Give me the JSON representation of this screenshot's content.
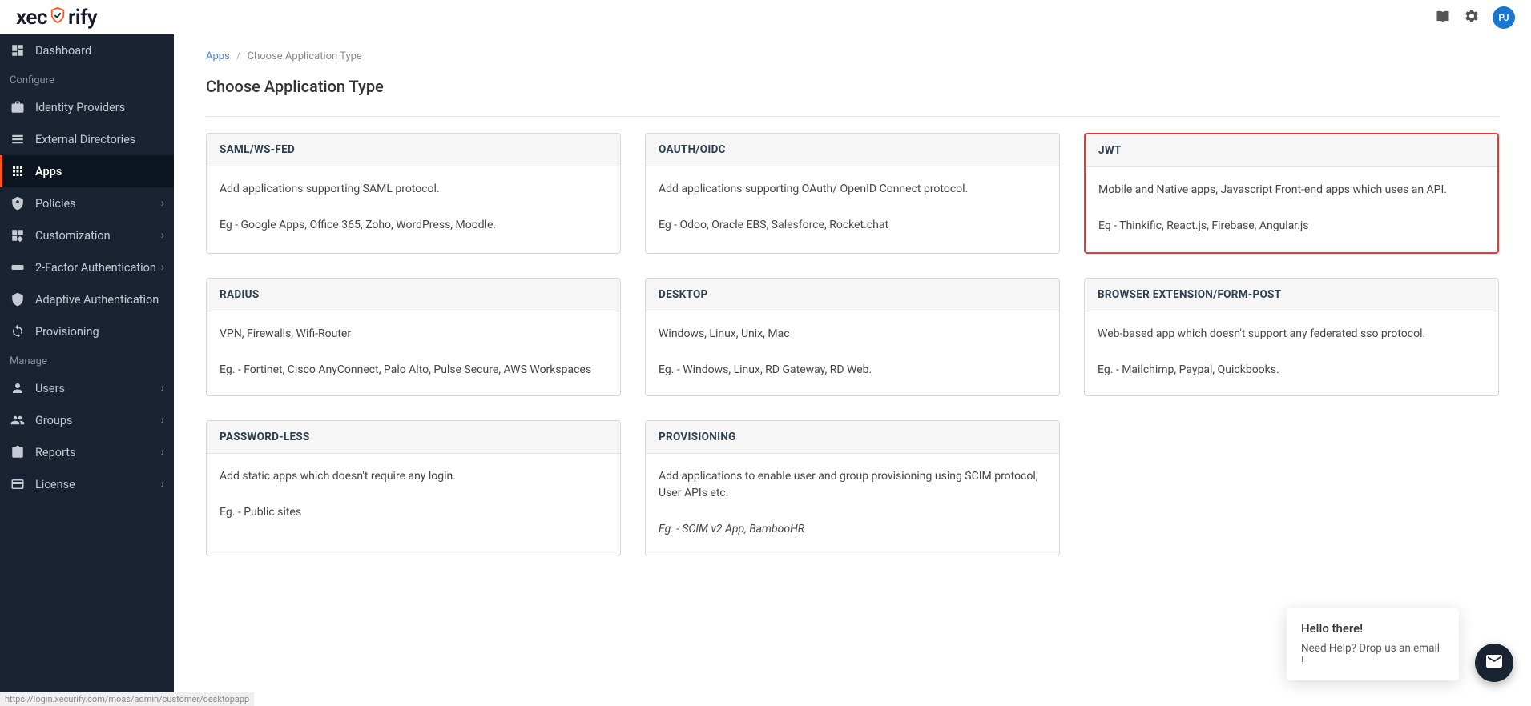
{
  "header": {
    "logo_prefix": "xec",
    "logo_suffix": "rify",
    "avatar": "PJ"
  },
  "sidebar": {
    "section_configure": "Configure",
    "section_manage": "Manage",
    "items": [
      {
        "label": "Dashboard"
      },
      {
        "label": "Identity Providers"
      },
      {
        "label": "External Directories"
      },
      {
        "label": "Apps"
      },
      {
        "label": "Policies"
      },
      {
        "label": "Customization"
      },
      {
        "label": "2-Factor Authentication"
      },
      {
        "label": "Adaptive Authentication"
      },
      {
        "label": "Provisioning"
      },
      {
        "label": "Users"
      },
      {
        "label": "Groups"
      },
      {
        "label": "Reports"
      },
      {
        "label": "License"
      }
    ]
  },
  "breadcrumb": {
    "root": "Apps",
    "current": "Choose Application Type"
  },
  "page": {
    "title": "Choose Application Type"
  },
  "cards": [
    {
      "title": "SAML/WS-FED",
      "desc": "Add applications supporting SAML protocol.",
      "eg": "Eg - Google Apps, Office 365, Zoho, WordPress, Moodle."
    },
    {
      "title": "OAUTH/OIDC",
      "desc": "Add applications supporting OAuth/ OpenID Connect protocol.",
      "eg": "Eg - Odoo, Oracle EBS, Salesforce, Rocket.chat"
    },
    {
      "title": "JWT",
      "desc": "Mobile and Native apps, Javascript Front-end apps which uses an API.",
      "eg": "Eg - Thinkific, React.js, Firebase, Angular.js"
    },
    {
      "title": "RADIUS",
      "desc": "VPN, Firewalls, Wifi-Router",
      "eg": "Eg. - Fortinet, Cisco AnyConnect, Palo Alto, Pulse Secure, AWS Workspaces"
    },
    {
      "title": "DESKTOP",
      "desc": "Windows, Linux, Unix, Mac",
      "eg": "Eg. - Windows, Linux, RD Gateway, RD Web."
    },
    {
      "title": "BROWSER EXTENSION/FORM-POST",
      "desc": "Web-based app which doesn't support any federated sso protocol.",
      "eg": "Eg. - Mailchimp, Paypal, Quickbooks."
    },
    {
      "title": "PASSWORD-LESS",
      "desc": "Add static apps which doesn't require any login.",
      "eg": "Eg. - Public sites"
    },
    {
      "title": "PROVISIONING",
      "desc": "Add applications to enable user and group provisioning using SCIM protocol, User APIs etc.",
      "eg": "Eg. - SCIM v2 App, BambooHR"
    }
  ],
  "chat": {
    "title": "Hello there!",
    "sub": "Need Help? Drop us an email !"
  },
  "status": "https://login.xecurify.com/moas/admin/customer/desktopapp"
}
